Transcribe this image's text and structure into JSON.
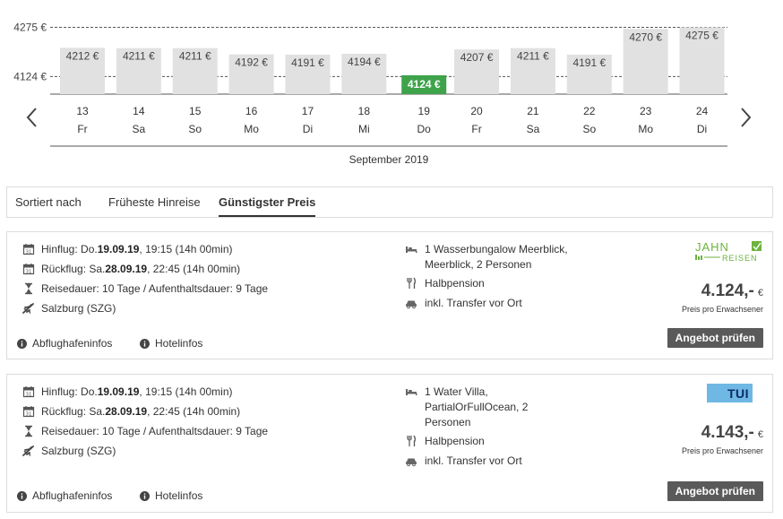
{
  "chart_data": {
    "type": "bar",
    "y_ticks": [
      {
        "value": 4275,
        "label": "4275 €"
      },
      {
        "value": 4124,
        "label": "4124 €"
      }
    ],
    "ylim": [
      4070,
      4290
    ],
    "bars": [
      {
        "day": "13",
        "weekday": "Fr",
        "value": 4212,
        "label": "4212 €",
        "highlight": false
      },
      {
        "day": "14",
        "weekday": "Sa",
        "value": 4211,
        "label": "4211 €",
        "highlight": false
      },
      {
        "day": "15",
        "weekday": "So",
        "value": 4211,
        "label": "4211 €",
        "highlight": false
      },
      {
        "day": "16",
        "weekday": "Mo",
        "value": 4192,
        "label": "4192 €",
        "highlight": false
      },
      {
        "day": "17",
        "weekday": "Di",
        "value": 4191,
        "label": "4191 €",
        "highlight": false
      },
      {
        "day": "18",
        "weekday": "Mi",
        "value": 4194,
        "label": "4194 €",
        "highlight": false
      },
      {
        "day": "19",
        "weekday": "Do",
        "value": 4124,
        "label": "4124 €",
        "highlight": true
      },
      {
        "day": "20",
        "weekday": "Fr",
        "value": 4207,
        "label": "4207 €",
        "highlight": false
      },
      {
        "day": "21",
        "weekday": "Sa",
        "value": 4211,
        "label": "4211 €",
        "highlight": false
      },
      {
        "day": "22",
        "weekday": "So",
        "value": 4191,
        "label": "4191 €",
        "highlight": false
      },
      {
        "day": "23",
        "weekday": "Mo",
        "value": 4270,
        "label": "4270 €",
        "highlight": false
      },
      {
        "day": "24",
        "weekday": "Di",
        "value": 4275,
        "label": "4275 €",
        "highlight": false
      }
    ],
    "month_label": "September 2019",
    "colors": {
      "bar": "#e1e1e1",
      "highlight": "#3ea34a",
      "label": "#444444",
      "highlight_label": "#ffffff"
    }
  },
  "sort": {
    "label": "Sortiert nach",
    "options": [
      {
        "label": "Früheste Hinreise",
        "active": false
      },
      {
        "label": "Günstigster Preis",
        "active": true
      }
    ]
  },
  "offers": [
    {
      "outbound_prefix": "Hinflug: Do. ",
      "outbound_date": "19.09.19",
      "outbound_suffix": ", 19:15 (14h 00min)",
      "return_prefix": "Rückflug: Sa. ",
      "return_date": "28.09.19",
      "return_suffix": ", 22:45 (14h 00min)",
      "duration": "Reisedauer: 10 Tage / Aufenthaltsdauer: 9 Tage",
      "airport": "Salzburg (SZG)",
      "room": "1 Wasserbungalow Meerblick,\nMeerblick, 2 Personen",
      "board": "Halbpension",
      "transfer": "inkl. Transfer vor Ort",
      "price": "4.124,-",
      "currency": "€",
      "price_note": "Preis pro Erwachsener",
      "button": "Angebot prüfen",
      "link_airport": "Abflughafeninfos",
      "link_hotel": "Hotelinfos",
      "operator_logo_text": [
        "JAHN",
        "REISEN"
      ],
      "operator_color": "#6db33f"
    },
    {
      "outbound_prefix": "Hinflug: Do. ",
      "outbound_date": "19.09.19",
      "outbound_suffix": ", 19:15 (14h 00min)",
      "return_prefix": "Rückflug: Sa. ",
      "return_date": "28.09.19",
      "return_suffix": ", 22:45 (14h 00min)",
      "duration": "Reisedauer: 10 Tage / Aufenthaltsdauer: 9 Tage",
      "airport": "Salzburg (SZG)",
      "room": "1 Water Villa,\nPartialOrFullOcean, 2\nPersonen",
      "board": "Halbpension",
      "transfer": "inkl. Transfer vor Ort",
      "price": "4.143,-",
      "currency": "€",
      "price_note": "Preis pro Erwachsener",
      "button": "Angebot prüfen",
      "link_airport": "Abflughafeninfos",
      "link_hotel": "Hotelinfos",
      "operator_logo_text": [
        "TUI"
      ],
      "operator_color": "#6fb8e3"
    }
  ]
}
